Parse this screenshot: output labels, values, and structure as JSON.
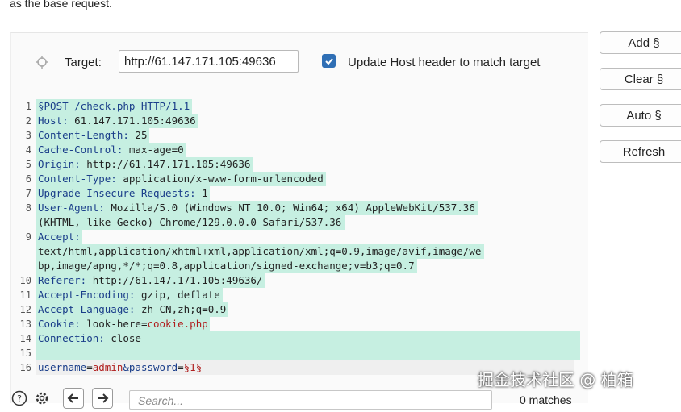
{
  "header": {
    "note": "as the base request."
  },
  "target": {
    "label": "Target:",
    "value": "http://61.147.171.105:49636",
    "update_host_label": "Update Host header to match target",
    "update_host_checked": true
  },
  "sidebar_buttons": {
    "add": "Add §",
    "clear": "Clear §",
    "auto": "Auto §",
    "refresh": "Refresh"
  },
  "request": {
    "line_numbers": [
      "1",
      "2",
      "3",
      "4",
      "5",
      "6",
      "7",
      "8",
      "",
      "9",
      "",
      "",
      "10",
      "11",
      "12",
      "13",
      "14",
      "15",
      "16"
    ],
    "lines": [
      {
        "k": "§POST /check.php HTTP/1.1",
        "v": ""
      },
      {
        "k": "Host:",
        "v": " 61.147.171.105:49636"
      },
      {
        "k": "Content-Length:",
        "v": " 25"
      },
      {
        "k": "Cache-Control:",
        "v": " max-age=0"
      },
      {
        "k": "Origin:",
        "v": " http://61.147.171.105:49636"
      },
      {
        "k": "Content-Type:",
        "v": " application/x-www-form-urlencoded"
      },
      {
        "k": "Upgrade-Insecure-Requests:",
        "v": " 1"
      },
      {
        "k": "User-Agent:",
        "v": " Mozilla/5.0 (Windows NT 10.0; Win64; x64) AppleWebKit/537.36"
      },
      {
        "k": "",
        "v": "(KHTML, like Gecko) Chrome/129.0.0.0 Safari/537.36"
      },
      {
        "k": "Accept:",
        "v": ""
      },
      {
        "k": "",
        "v": "text/html,application/xhtml+xml,application/xml;q=0.9,image/avif,image/we"
      },
      {
        "k": "",
        "v": "bp,image/apng,*/*;q=0.8,application/signed-exchange;v=b3;q=0.7"
      },
      {
        "k": "Referer:",
        "v": " http://61.147.171.105:49636/"
      },
      {
        "k": "Accept-Encoding:",
        "v": " gzip, deflate"
      },
      {
        "k": "Accept-Language:",
        "v": " zh-CN,zh;q=0.9"
      },
      {
        "k": "Cookie:",
        "v": " look-here=",
        "r": "cookie.php"
      },
      {
        "k": "Connection:",
        "v": " close"
      },
      {
        "k": "",
        "v": ""
      },
      {
        "k": "username",
        "v": "=",
        "r": "admin",
        "k2": "&password",
        "v2": "=",
        "r2": "§1§"
      }
    ]
  },
  "search": {
    "placeholder": "Search...",
    "matches": "0 matches"
  },
  "watermark": "掘金技术社区 @ 柏箱",
  "colors": {
    "highlight": "#c6efe1",
    "key": "#1a3e8a",
    "red": "#b02020",
    "checkbox": "#2f6fb5"
  }
}
